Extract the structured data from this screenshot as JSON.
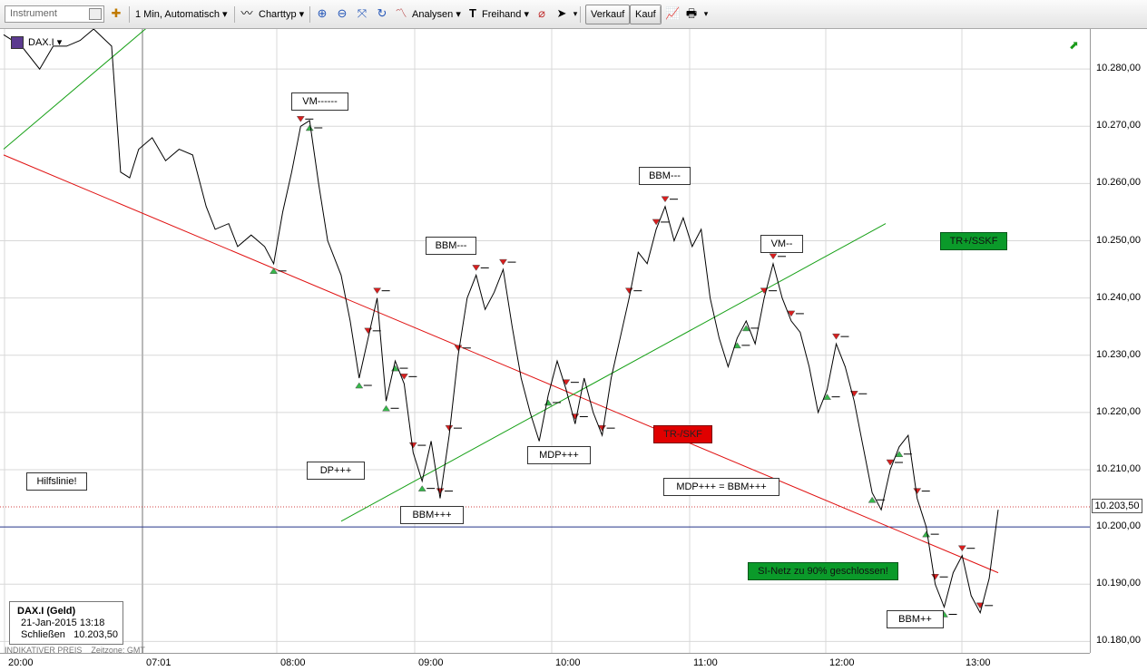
{
  "toolbar": {
    "instrument_placeholder": "Instrument",
    "interval": "1 Min,  Automatisch",
    "charttype": "Charttyp",
    "analysen": "Analysen",
    "freihand": "Freihand",
    "verkauf": "Verkauf",
    "kauf": "Kauf"
  },
  "symbol": "DAX.I",
  "legend": {
    "title": "DAX.I (Geld)",
    "date": "21-Jan-2015 13:18",
    "close_label": "Schließen",
    "close_value": "10.203,50"
  },
  "footer": {
    "left": "INDIKATIVER PREIS",
    "right": "Zeitzone: GMT"
  },
  "last_price": "10.203,50",
  "annotations": [
    {
      "text": "VM------"
    },
    {
      "text": "BBM---"
    },
    {
      "text": "BBM---"
    },
    {
      "text": "VM--"
    },
    {
      "text": "TR+/SSKF"
    },
    {
      "text": "TR-/SKF"
    },
    {
      "text": "DP+++"
    },
    {
      "text": "MDP+++"
    },
    {
      "text": "MDP+++ = BBM+++"
    },
    {
      "text": "BBM+++"
    },
    {
      "text": "Hilfslinie!"
    },
    {
      "text": "SI-Netz zu 90% geschlossen!"
    },
    {
      "text": "BBM++"
    }
  ],
  "colors": {
    "price": "#000000",
    "red_line": "#e01010",
    "green_line": "#16a016",
    "blue_line": "#2b3a8f",
    "dotted": "#d04040"
  },
  "chart_data": {
    "type": "line",
    "ylim": [
      10178,
      10287
    ],
    "ticks_y": [
      "10.280,00",
      "10.270,00",
      "10.260,00",
      "10.250,00",
      "10.240,00",
      "10.230,00",
      "10.220,00",
      "10.210,00",
      "10.200,00",
      "10.190,00",
      "10.180,00"
    ],
    "ticks_x": [
      "20:00",
      "07:01",
      "08:00",
      "09:00",
      "10:00",
      "11:00",
      "12:00",
      "13:00"
    ],
    "series": [
      {
        "values": [
          [
            0,
            10286
          ],
          [
            4,
            10284
          ],
          [
            8,
            10280
          ],
          [
            11,
            10284
          ],
          [
            14,
            10284
          ],
          [
            17,
            10285
          ],
          [
            20,
            10287
          ],
          [
            24,
            10284
          ],
          [
            26,
            10262
          ],
          [
            28,
            10261
          ],
          [
            30,
            10266
          ],
          [
            33,
            10268
          ],
          [
            36,
            10264
          ],
          [
            39,
            10266
          ],
          [
            42,
            10265
          ],
          [
            45,
            10256
          ],
          [
            47,
            10252
          ],
          [
            50,
            10253
          ],
          [
            52,
            10249
          ],
          [
            55,
            10251
          ],
          [
            58,
            10249
          ],
          [
            60,
            10246
          ],
          [
            62,
            10255
          ],
          [
            64,
            10262
          ],
          [
            66,
            10270
          ],
          [
            68,
            10271
          ],
          [
            70,
            10260
          ],
          [
            72,
            10250
          ],
          [
            75,
            10244
          ],
          [
            77,
            10236
          ],
          [
            79,
            10226
          ],
          [
            81,
            10233
          ],
          [
            83,
            10240
          ],
          [
            85,
            10222
          ],
          [
            87,
            10229
          ],
          [
            89,
            10225
          ],
          [
            91,
            10213
          ],
          [
            93,
            10208
          ],
          [
            95,
            10215
          ],
          [
            97,
            10205
          ],
          [
            99,
            10216
          ],
          [
            101,
            10230
          ],
          [
            103,
            10240
          ],
          [
            105,
            10244
          ],
          [
            107,
            10238
          ],
          [
            109,
            10241
          ],
          [
            111,
            10245
          ],
          [
            113,
            10235
          ],
          [
            115,
            10226
          ],
          [
            117,
            10220
          ],
          [
            119,
            10215
          ],
          [
            121,
            10223
          ],
          [
            123,
            10229
          ],
          [
            125,
            10224
          ],
          [
            127,
            10218
          ],
          [
            129,
            10226
          ],
          [
            131,
            10220
          ],
          [
            133,
            10216
          ],
          [
            135,
            10226
          ],
          [
            137,
            10233
          ],
          [
            139,
            10240
          ],
          [
            141,
            10248
          ],
          [
            143,
            10246
          ],
          [
            145,
            10252
          ],
          [
            147,
            10256
          ],
          [
            149,
            10250
          ],
          [
            151,
            10254
          ],
          [
            153,
            10249
          ],
          [
            155,
            10252
          ],
          [
            157,
            10240
          ],
          [
            159,
            10233
          ],
          [
            161,
            10228
          ],
          [
            163,
            10233
          ],
          [
            165,
            10236
          ],
          [
            167,
            10232
          ],
          [
            169,
            10240
          ],
          [
            171,
            10246
          ],
          [
            173,
            10240
          ],
          [
            175,
            10236
          ],
          [
            177,
            10234
          ],
          [
            179,
            10228
          ],
          [
            181,
            10220
          ],
          [
            183,
            10224
          ],
          [
            185,
            10232
          ],
          [
            187,
            10228
          ],
          [
            189,
            10222
          ],
          [
            191,
            10214
          ],
          [
            193,
            10206
          ],
          [
            195,
            10203
          ],
          [
            197,
            10210
          ],
          [
            199,
            10214
          ],
          [
            201,
            10216
          ],
          [
            203,
            10205
          ],
          [
            205,
            10200
          ],
          [
            207,
            10190
          ],
          [
            209,
            10186
          ],
          [
            211,
            10192
          ],
          [
            213,
            10195
          ],
          [
            215,
            10188
          ],
          [
            217,
            10185
          ],
          [
            219,
            10191
          ],
          [
            221,
            10203
          ]
        ]
      }
    ],
    "red_trendline": [
      [
        0,
        10265
      ],
      [
        221,
        10192
      ]
    ],
    "green_trendline_1": [
      [
        0,
        10266
      ],
      [
        33,
        10288
      ]
    ],
    "green_trendline_2": [
      [
        75,
        10201
      ],
      [
        196,
        10253
      ]
    ],
    "blue_hline": 10200,
    "dotted_hline": 10203.5
  }
}
